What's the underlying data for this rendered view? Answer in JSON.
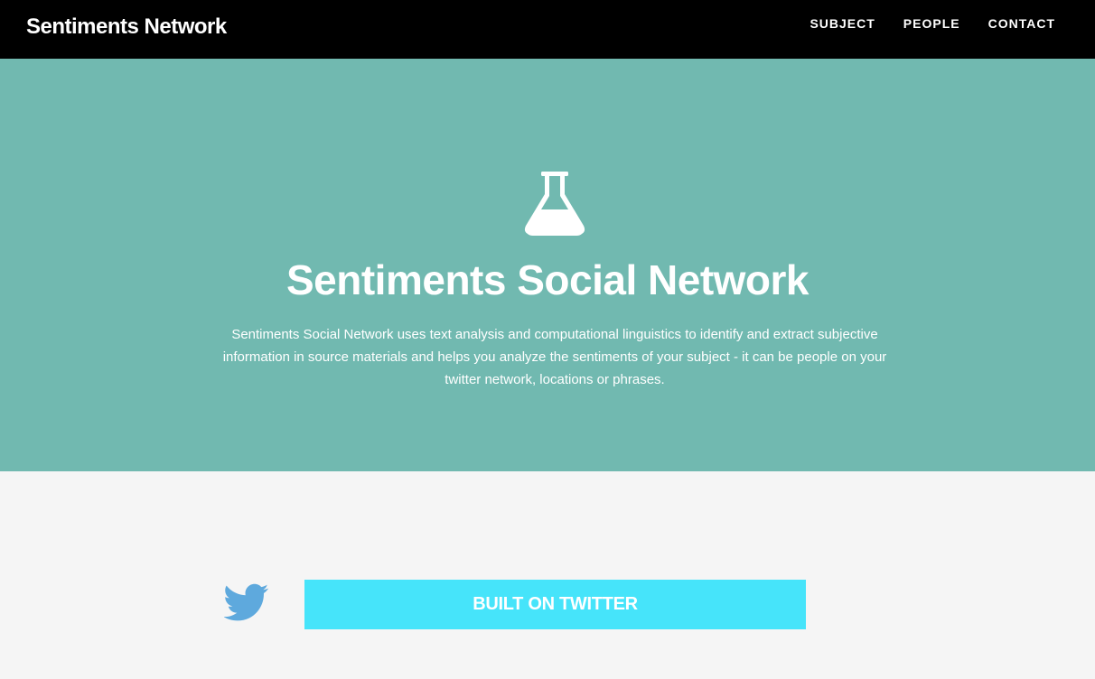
{
  "navbar": {
    "brand": "Sentiments Network",
    "links": [
      "SUBJECT",
      "PEOPLE",
      "CONTACT"
    ]
  },
  "hero": {
    "icon": "flask-icon",
    "title": "Sentiments Social Network",
    "description": "Sentiments Social Network uses text analysis and computational linguistics to identify and extract subjective information in source materials and helps you analyze the sentiments of your subject - it can be people on your twitter network, locations or phrases."
  },
  "twitter": {
    "icon": "twitter-bird-icon",
    "button_label": "BUILT ON TWITTER"
  },
  "colors": {
    "navbar_bg": "#000000",
    "hero_bg": "#71b9b0",
    "section_bg": "#f5f5f5",
    "button_bg": "#46e4fa",
    "twitter_blue": "#5ea9dd"
  }
}
